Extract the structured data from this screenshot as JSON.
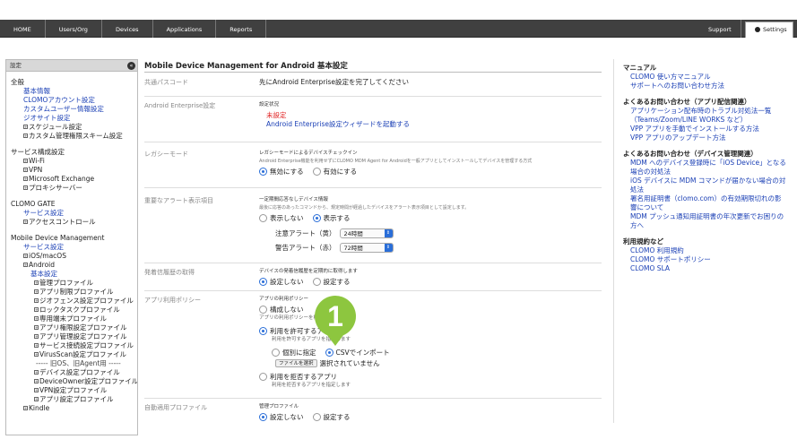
{
  "topnav": {
    "items": [
      "HOME",
      "Users/Org",
      "Devices",
      "Applications",
      "Reports"
    ],
    "support": "Support",
    "settings": "Settings"
  },
  "sidebar": {
    "header": "設定",
    "collapse": "«",
    "sections": [
      {
        "title": "全般",
        "items": [
          {
            "label": "基本情報",
            "link": true,
            "plus": false,
            "level": 1
          },
          {
            "label": "CLOMOアカウント設定",
            "link": true,
            "plus": false,
            "level": 1
          },
          {
            "label": "カスタムユーザー情報設定",
            "link": true,
            "plus": false,
            "level": 1
          },
          {
            "label": "ジオサイト設定",
            "link": true,
            "plus": false,
            "level": 1
          },
          {
            "label": "スケジュール設定",
            "link": false,
            "plus": true,
            "level": 2
          },
          {
            "label": "カスタム管理権限スキーム設定",
            "link": false,
            "plus": true,
            "level": 2
          }
        ]
      },
      {
        "title": "サービス構成設定",
        "items": [
          {
            "label": "Wi-Fi",
            "link": false,
            "plus": true,
            "level": 2
          },
          {
            "label": "VPN",
            "link": false,
            "plus": true,
            "level": 2
          },
          {
            "label": "Microsoft Exchange",
            "link": false,
            "plus": true,
            "level": 2
          },
          {
            "label": "プロキシサーバー",
            "link": false,
            "plus": true,
            "level": 2
          }
        ]
      },
      {
        "title": "CLOMO GATE",
        "items": [
          {
            "label": "サービス設定",
            "link": true,
            "plus": false,
            "level": 1
          },
          {
            "label": "アクセスコントロール",
            "link": false,
            "plus": true,
            "level": 2
          }
        ]
      },
      {
        "title": "Mobile Device Management",
        "items": [
          {
            "label": "サービス設定",
            "link": true,
            "plus": false,
            "level": 1
          },
          {
            "label": "iOS/macOS",
            "link": false,
            "plus": true,
            "level": 2
          },
          {
            "label": "Android",
            "link": false,
            "plus": true,
            "level": 2
          },
          {
            "label": "基本設定",
            "link": true,
            "plus": false,
            "level": 3
          },
          {
            "label": "管理プロファイル",
            "link": false,
            "plus": true,
            "level": 4
          },
          {
            "label": "アプリ制限プロファイル",
            "link": false,
            "plus": true,
            "level": 4
          },
          {
            "label": "ジオフェンス設定プロファイル",
            "link": false,
            "plus": true,
            "level": 4
          },
          {
            "label": "ロックタスクプロファイル",
            "link": false,
            "plus": true,
            "level": 4
          },
          {
            "label": "専用端末プロファイル",
            "link": false,
            "plus": true,
            "level": 4
          },
          {
            "label": "アプリ権限設定プロファイル",
            "link": false,
            "plus": true,
            "level": 4
          },
          {
            "label": "アプリ管理設定プロファイル",
            "link": false,
            "plus": true,
            "level": 4
          },
          {
            "label": "サービス接続設定プロファイル",
            "link": false,
            "plus": true,
            "level": 4
          },
          {
            "label": "VirusScan設定プロファイル",
            "link": false,
            "plus": true,
            "level": 4
          },
          {
            "label": "----- 旧OS、旧Agent用 -----",
            "link": false,
            "plus": false,
            "level": 5
          },
          {
            "label": "デバイス設定プロファイル",
            "link": false,
            "plus": true,
            "level": 4
          },
          {
            "label": "DeviceOwner設定プロファイル",
            "link": false,
            "plus": true,
            "level": 4
          },
          {
            "label": "VPN設定プロファイル",
            "link": false,
            "plus": true,
            "level": 4
          },
          {
            "label": "アプリ設定プロファイル",
            "link": false,
            "plus": true,
            "level": 4
          },
          {
            "label": "Kindle",
            "link": false,
            "plus": true,
            "level": 2
          }
        ]
      }
    ]
  },
  "main": {
    "title": "Mobile Device Management for Android 基本設定",
    "passcode": {
      "label": "共通パスコード",
      "value": "先にAndroid Enterprise設定を完了してください"
    },
    "enterprise": {
      "label": "Android Enterprise設定",
      "status_title": "設定状況",
      "status": "未設定",
      "wizard_link": "Android Enterprise設定ウィザードを起動する"
    },
    "legacy": {
      "label": "レガシーモード",
      "title": "レガシーモードによるデバイスチェックイン",
      "desc": "Android Enterprise機能を利用せずにCLOMO MDM Agent for Androidを一般アプリとしてインストールしてデバイスを管理する方式",
      "opt_off": "無効にする",
      "opt_on": "有効にする"
    },
    "alert": {
      "label": "重要なアラート表示項目",
      "title": "一定期間応答なしデバイス情報",
      "desc": "最後に応答のあったコマンドから、規定時間が経過したデバイスをアラート表示項目として設定します。",
      "opt_hide": "表示しない",
      "opt_show": "表示する",
      "caution_label": "注意アラート（黄）",
      "caution_value": "24時間",
      "warn_label": "警告アラート（赤）",
      "warn_value": "72時間"
    },
    "history": {
      "label": "発着信履歴の取得",
      "title": "デバイスの発着信履歴を定期的に取得します",
      "opt_off": "設定しない",
      "opt_on": "設定する"
    },
    "apppolicy": {
      "label": "アプリ利用ポリシー",
      "title": "アプリの利用ポリシー",
      "opt_none": "構成しない",
      "none_desc": "アプリの利用ポリシーを構成しません。",
      "opt_allow": "利用を許可するアプリ",
      "allow_desc": "利用を許可するアプリを指定します",
      "opt_individual": "個別に指定",
      "opt_csv": "CSVでインポート",
      "file_btn": "ファイルを選択",
      "file_status": "選択されていません",
      "opt_deny": "利用を拒否するアプリ",
      "deny_desc": "利用を拒否するアプリを指定します"
    },
    "autoapply": {
      "label": "自動適用プロファイル",
      "title": "管理プロファイル",
      "opt_off": "設定しない",
      "opt_on": "設定する"
    }
  },
  "badge": "1",
  "rightpanel": {
    "sections": [
      {
        "title": "マニュアル",
        "links": [
          "CLOMO 使い方マニュアル",
          "サポートへのお問い合わせ方法"
        ]
      },
      {
        "title": "よくあるお問い合わせ（アプリ配信関連）",
        "links": [
          "アプリケーション配布時のトラブル対処法一覧",
          "（Teams/Zoom/LINE WORKS など）",
          "VPP アプリを手動でインストールする方法",
          "VPP アプリのアップデート方法"
        ]
      },
      {
        "title": "よくあるお問い合わせ（デバイス管理関連）",
        "links": [
          "MDM へのデバイス登録時に「iOS Device」となる",
          "場合の対処法",
          "iOS デバイスに MDM コマンドが届かない場合の対",
          "処法",
          "署名用証明書（clomo.com）の有効期限切れの影",
          "響について",
          "MDM プッシュ通知用証明書の年次更新でお困りの",
          "方へ"
        ]
      },
      {
        "title": "利用規約など",
        "links": [
          "CLOMO 利用規約",
          "CLOMO サポートポリシー",
          "CLOMO SLA"
        ]
      }
    ]
  }
}
